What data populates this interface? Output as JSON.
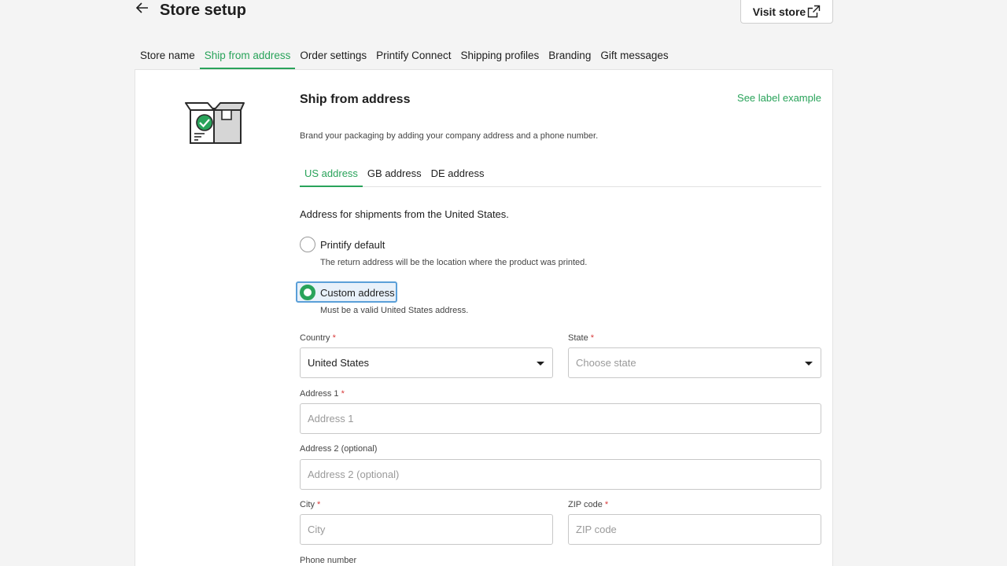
{
  "header": {
    "title": "Store setup",
    "visit_store": "Visit store"
  },
  "top_tabs": [
    {
      "label": "Store name"
    },
    {
      "label": "Ship from address",
      "active": true
    },
    {
      "label": "Order settings"
    },
    {
      "label": "Printify Connect"
    },
    {
      "label": "Shipping profiles"
    },
    {
      "label": "Branding"
    },
    {
      "label": "Gift messages"
    }
  ],
  "section": {
    "title": "Ship from address",
    "label_link": "See label example",
    "description": "Brand your packaging by adding your company address and a phone number."
  },
  "address_tabs": [
    {
      "label": "US address",
      "active": true
    },
    {
      "label": "GB address"
    },
    {
      "label": "DE address"
    }
  ],
  "shipments_text": "Address for shipments from the United States.",
  "options": {
    "default": {
      "label": "Printify default",
      "help": "The return address will be the location where the product was printed."
    },
    "custom": {
      "label": "Custom address",
      "help": "Must be a valid United States address."
    }
  },
  "form": {
    "country": {
      "label": "Country",
      "required": "*",
      "value": "United States"
    },
    "state": {
      "label": "State",
      "required": "*",
      "placeholder": "Choose state"
    },
    "address1": {
      "label": "Address 1",
      "required": "*",
      "placeholder": "Address 1"
    },
    "address2": {
      "label": "Address 2 (optional)",
      "placeholder": "Address 2 (optional)"
    },
    "city": {
      "label": "City",
      "required": "*",
      "placeholder": "City"
    },
    "zip": {
      "label": "ZIP code",
      "required": "*",
      "placeholder": "ZIP code"
    },
    "phone": {
      "label": "Phone number"
    }
  },
  "colors": {
    "accent": "#29a35a",
    "required": "#d83b3b",
    "focus": "#5a9fd8"
  }
}
